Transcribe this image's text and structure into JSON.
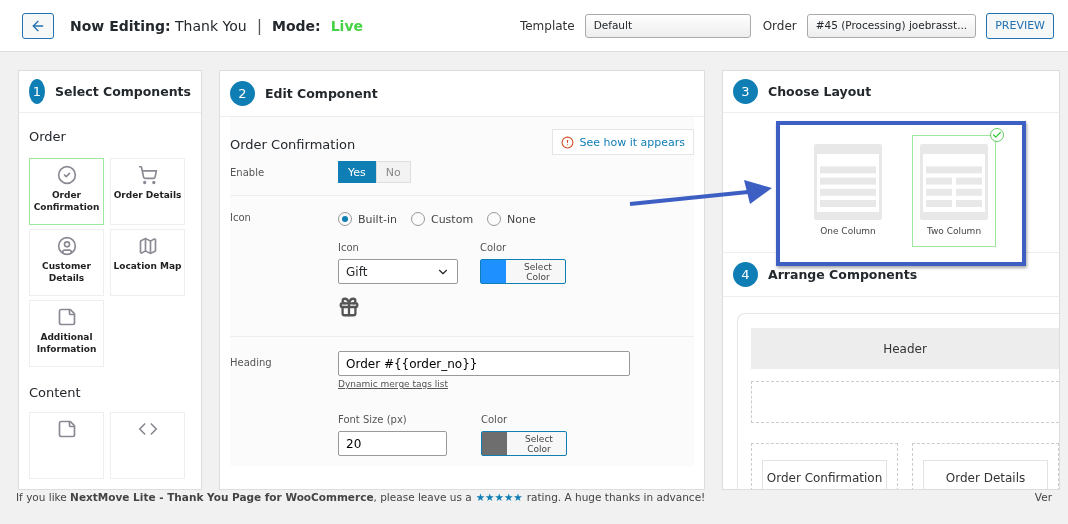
{
  "header": {
    "title_prefix": "Now Editing:",
    "title_value": "Thank You",
    "separator": "|",
    "mode_label": "Mode:",
    "mode_value": "Live",
    "template": {
      "label": "Template",
      "value": "Default"
    },
    "order": {
      "label": "Order",
      "value": "#45 (Processing) joebrasst..."
    },
    "preview_button": "PREVIEW"
  },
  "select_panel": {
    "step": "1",
    "title": "Select Components",
    "groups": [
      {
        "heading": "Order",
        "items": [
          {
            "label": "Order Confirmation",
            "kind": "check",
            "selected": true
          },
          {
            "label": "Order Details",
            "kind": "cart",
            "selected": false
          },
          {
            "label": "Customer Details",
            "kind": "user",
            "selected": false
          },
          {
            "label": "Location Map",
            "kind": "map",
            "selected": false
          },
          {
            "label": "Additional Information",
            "kind": "note",
            "selected": false
          }
        ]
      },
      {
        "heading": "Content",
        "items": [
          {
            "kind": "note",
            "selected": false
          },
          {
            "kind": "code",
            "selected": false
          }
        ]
      }
    ]
  },
  "edit_panel": {
    "step": "2",
    "title": "Edit Component",
    "section_title": "Order Confirmation",
    "preview_link": "See how it appears",
    "enable": {
      "label": "Enable",
      "options": [
        {
          "label": "Yes",
          "selected": true
        },
        {
          "label": "No",
          "selected": false
        }
      ]
    },
    "icon": {
      "label": "Icon",
      "radios": [
        {
          "label": "Built-in",
          "selected": true
        },
        {
          "label": "Custom",
          "selected": false
        },
        {
          "label": "None",
          "selected": false
        }
      ],
      "select": {
        "label": "Icon",
        "value": "Gift"
      },
      "color": {
        "label": "Color",
        "button": "Select Color",
        "color": "#1e90ff"
      }
    },
    "heading": {
      "label": "Heading",
      "value": "Order #{{order_no}}",
      "link": "Dynamic merge tags list",
      "font_size": {
        "label": "Font Size (px)",
        "value": "20"
      },
      "color": {
        "label": "Color",
        "button": "Select Color",
        "color": "#6e6e6e"
      }
    }
  },
  "layout_panel": {
    "step": "3",
    "title": "Choose Layout",
    "options": [
      {
        "label": "One Column",
        "kind": "one",
        "selected": false
      },
      {
        "label": "Two Column",
        "kind": "two",
        "selected": true
      }
    ]
  },
  "arrange_panel": {
    "step": "4",
    "title": "Arrange Components",
    "header": "Header",
    "cards": [
      "Order Confirmation",
      "Order Details"
    ]
  },
  "footer": {
    "text_before": "If you like **NextMove Lite - Thank You Page for WooCommerce**, please leave us a",
    "rating_link": "★★★★★",
    "text_after": "rating. A huge thanks in advance!",
    "version": "Ver"
  }
}
